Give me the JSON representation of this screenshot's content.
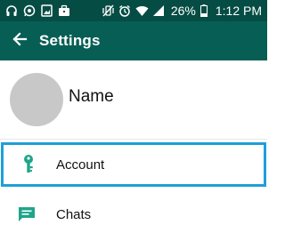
{
  "status_bar": {
    "left_icons": [
      "headphones-icon",
      "whatsapp-icon",
      "image-icon",
      "briefcase-icon"
    ],
    "right_icons": [
      "vibrate-icon",
      "alarm-icon",
      "wifi-icon",
      "signal-icon",
      "battery-icon"
    ],
    "battery_percent": "26%",
    "time": "1:12 PM"
  },
  "toolbar": {
    "title": "Settings",
    "back_icon": "back-arrow-icon"
  },
  "profile": {
    "name": "Name"
  },
  "menu": {
    "items": [
      {
        "label": "Account",
        "icon": "key-icon",
        "selected": true
      },
      {
        "label": "Chats",
        "icon": "chat-icon",
        "selected": false
      }
    ]
  },
  "colors": {
    "status_bar": "#054d44",
    "toolbar": "#075e54",
    "accent_teal": "#1ea58a",
    "highlight_border": "#1e9fd8",
    "avatar_gray": "#c8c8c8"
  }
}
